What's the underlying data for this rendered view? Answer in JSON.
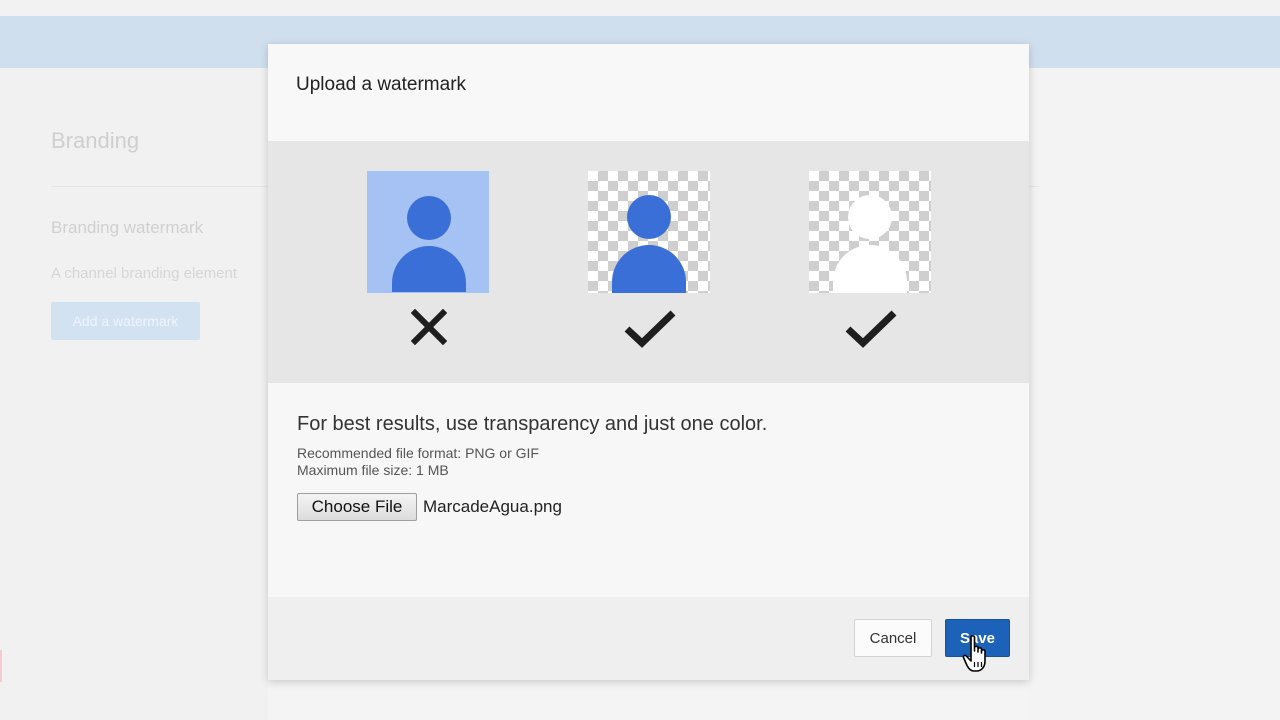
{
  "background": {
    "heading": "Branding",
    "section_title": "Branding watermark",
    "section_description": "A channel branding element",
    "add_button_label": "Add a watermark"
  },
  "dialog": {
    "title": "Upload a watermark",
    "examples": [
      {
        "style": "solid-background",
        "icon": "person-icon",
        "verdict": "x-mark-icon",
        "accepted": false
      },
      {
        "style": "transparent-background",
        "icon": "person-icon",
        "verdict": "check-mark-icon",
        "accepted": true
      },
      {
        "style": "transparent-background-white",
        "icon": "person-icon",
        "verdict": "check-mark-icon",
        "accepted": true
      }
    ],
    "tip": "For best results, use transparency and just one color.",
    "recommended_format": "Recommended file format: PNG or GIF",
    "max_size": "Maximum file size: 1 MB",
    "choose_file_label": "Choose File",
    "selected_file": "MarcadeAgua.png",
    "cancel_label": "Cancel",
    "save_label": "Save"
  },
  "colors": {
    "accent_blue": "#1c62b9",
    "header_bar": "#cfdfee",
    "icon_blue": "#3b6fd8",
    "solid_bg": "#a6c2f4"
  }
}
